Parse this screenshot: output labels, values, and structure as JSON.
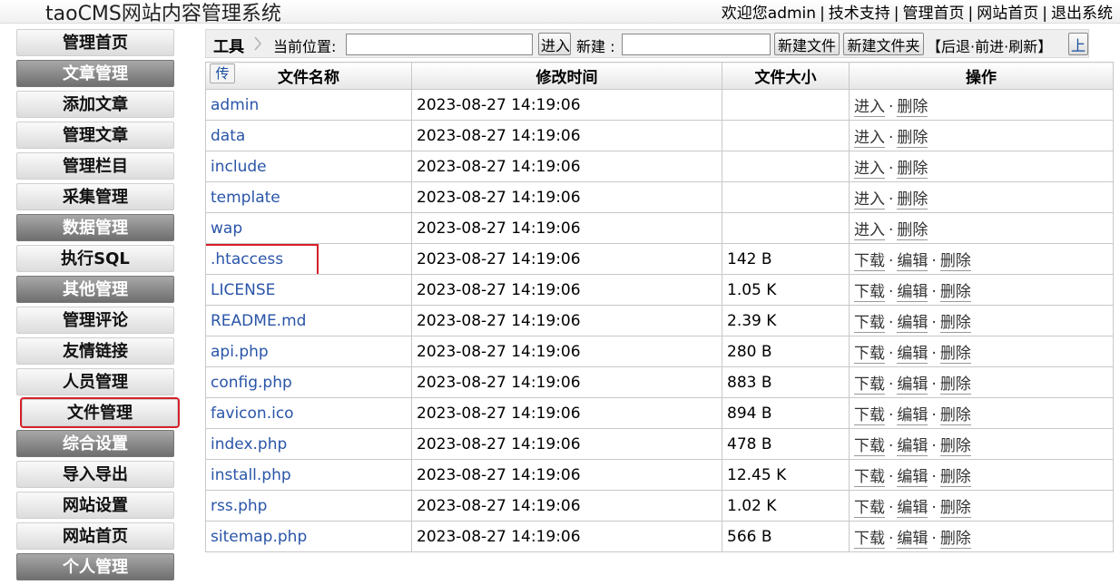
{
  "header": {
    "title": "taoCMS网站内容管理系统",
    "links": [
      {
        "label": "欢迎您admin"
      },
      {
        "label": "技术支持"
      },
      {
        "label": "管理首页"
      },
      {
        "label": "网站首页"
      },
      {
        "label": "退出系统"
      }
    ]
  },
  "sidebar": {
    "items": [
      {
        "label": "管理首页",
        "type": "link"
      },
      {
        "label": "文章管理",
        "type": "group"
      },
      {
        "label": "添加文章",
        "type": "link"
      },
      {
        "label": "管理文章",
        "type": "link"
      },
      {
        "label": "管理栏目",
        "type": "link"
      },
      {
        "label": "采集管理",
        "type": "link"
      },
      {
        "label": "数据管理",
        "type": "group"
      },
      {
        "label": "执行SQL",
        "type": "link"
      },
      {
        "label": "其他管理",
        "type": "group"
      },
      {
        "label": "管理评论",
        "type": "link"
      },
      {
        "label": "友情链接",
        "type": "link"
      },
      {
        "label": "人员管理",
        "type": "link"
      },
      {
        "label": "文件管理",
        "type": "link",
        "highlighted": true
      },
      {
        "label": "综合设置",
        "type": "group"
      },
      {
        "label": "导入导出",
        "type": "link"
      },
      {
        "label": "网站设置",
        "type": "link"
      },
      {
        "label": "网站首页",
        "type": "link"
      },
      {
        "label": "个人管理",
        "type": "group"
      }
    ]
  },
  "toolbar": {
    "tools_label": "工具",
    "position_label": "当前位置:",
    "position_value": "",
    "enter_button": "进入",
    "new_label": "新建 :",
    "new_value": "",
    "new_file_button": "新建文件",
    "new_folder_button": "新建文件夹",
    "nav_open": "【",
    "nav_back": "后退",
    "nav_forward": "前进",
    "nav_refresh": "刷新",
    "nav_close": "】",
    "nav_dot": "·",
    "up_button": "上"
  },
  "table": {
    "upload_button": "传",
    "headers": {
      "name": "文件名称",
      "modified": "修改时间",
      "size": "文件大小",
      "actions": "操作"
    },
    "action_labels": {
      "enter": "进入",
      "delete": "删除",
      "download": "下载",
      "edit": "编辑",
      "dot": "·"
    },
    "rows": [
      {
        "name": "admin",
        "modified": "2023-08-27 14:19:06",
        "size": "",
        "is_dir": true
      },
      {
        "name": "data",
        "modified": "2023-08-27 14:19:06",
        "size": "",
        "is_dir": true
      },
      {
        "name": "include",
        "modified": "2023-08-27 14:19:06",
        "size": "",
        "is_dir": true
      },
      {
        "name": "template",
        "modified": "2023-08-27 14:19:06",
        "size": "",
        "is_dir": true
      },
      {
        "name": "wap",
        "modified": "2023-08-27 14:19:06",
        "size": "",
        "is_dir": true
      },
      {
        "name": ".htaccess",
        "modified": "2023-08-27 14:19:06",
        "size": "142 B",
        "is_dir": false,
        "highlighted": true
      },
      {
        "name": "LICENSE",
        "modified": "2023-08-27 14:19:06",
        "size": "1.05 K",
        "is_dir": false
      },
      {
        "name": "README.md",
        "modified": "2023-08-27 14:19:06",
        "size": "2.39 K",
        "is_dir": false
      },
      {
        "name": "api.php",
        "modified": "2023-08-27 14:19:06",
        "size": "280 B",
        "is_dir": false
      },
      {
        "name": "config.php",
        "modified": "2023-08-27 14:19:06",
        "size": "883 B",
        "is_dir": false
      },
      {
        "name": "favicon.ico",
        "modified": "2023-08-27 14:19:06",
        "size": "894 B",
        "is_dir": false
      },
      {
        "name": "index.php",
        "modified": "2023-08-27 14:19:06",
        "size": "478 B",
        "is_dir": false
      },
      {
        "name": "install.php",
        "modified": "2023-08-27 14:19:06",
        "size": "12.45 K",
        "is_dir": false
      },
      {
        "name": "rss.php",
        "modified": "2023-08-27 14:19:06",
        "size": "1.02 K",
        "is_dir": false
      },
      {
        "name": "sitemap.php",
        "modified": "2023-08-27 14:19:06",
        "size": "566 B",
        "is_dir": false
      }
    ]
  },
  "colors": {
    "highlight_box": "#d6202a",
    "link_blue": "#2a55a8",
    "group_bg": "#8a8a8a"
  }
}
